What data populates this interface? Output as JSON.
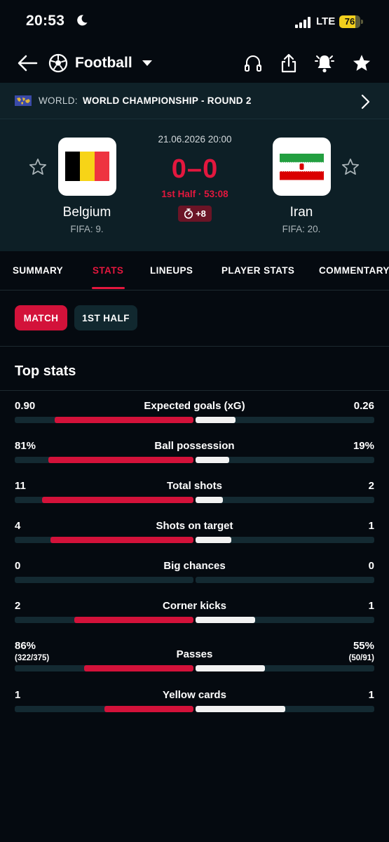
{
  "status_bar": {
    "time": "20:53",
    "network": "LTE",
    "battery": "76"
  },
  "app_bar": {
    "sport": "Football"
  },
  "competition": {
    "country": "WORLD:",
    "name": "WORLD CHAMPIONSHIP - ROUND 2"
  },
  "match": {
    "date": "21.06.2026 20:00",
    "score": "0–0",
    "status": "1st Half · 53:08",
    "added_time": "+8",
    "home": {
      "name": "Belgium",
      "rank": "FIFA: 9."
    },
    "away": {
      "name": "Iran",
      "rank": "FIFA: 20."
    }
  },
  "tabs": [
    "SUMMARY",
    "STATS",
    "LINEUPS",
    "PLAYER STATS",
    "COMMENTARY"
  ],
  "active_tab": "STATS",
  "period_filters": {
    "active": "MATCH",
    "inactive": "1ST HALF"
  },
  "section_title": "Top stats",
  "stats": [
    {
      "label": "Expected goals (xG)",
      "home": "0.90",
      "away": "0.26",
      "home_share": 0.776,
      "away_share": 0.224
    },
    {
      "label": "Ball possession",
      "home": "81%",
      "away": "19%",
      "home_share": 0.81,
      "away_share": 0.19
    },
    {
      "label": "Total shots",
      "home": "11",
      "away": "2",
      "home_share": 0.846,
      "away_share": 0.154
    },
    {
      "label": "Shots on target",
      "home": "4",
      "away": "1",
      "home_share": 0.8,
      "away_share": 0.2
    },
    {
      "label": "Big chances",
      "home": "0",
      "away": "0",
      "home_share": 0,
      "away_share": 0
    },
    {
      "label": "Corner kicks",
      "home": "2",
      "away": "1",
      "home_share": 0.667,
      "away_share": 0.333
    },
    {
      "label": "Passes",
      "home": "86%",
      "away": "55%",
      "home_sub": "(322/375)",
      "away_sub": "(50/91)",
      "home_share": 0.61,
      "away_share": 0.39
    },
    {
      "label": "Yellow cards",
      "home": "1",
      "away": "1",
      "home_share": 0.5,
      "away_share": 0.5
    }
  ],
  "colors": {
    "accent": "#e3173e",
    "home_bar": "#d3123a",
    "away_bar": "#f2f2f2",
    "track": "#142a32",
    "background": "#050a10",
    "header_bg": "#0d1f26"
  }
}
